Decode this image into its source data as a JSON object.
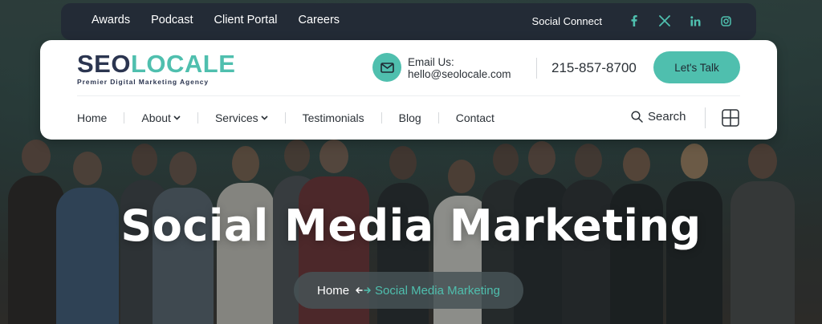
{
  "topbar": {
    "links": [
      "Awards",
      "Podcast",
      "Client Portal",
      "Careers"
    ],
    "social_label": "Social Connect",
    "social_icons": [
      "facebook-icon",
      "x-icon",
      "linkedin-icon",
      "instagram-icon"
    ]
  },
  "header": {
    "logo": {
      "seo": "SEO",
      "locale": "LOCALE",
      "tagline": "Premier Digital Marketing Agency"
    },
    "email_label": "Email Us:",
    "email": "hello@seolocale.com",
    "phone": "215-857-8700",
    "cta": "Let's Talk"
  },
  "nav": {
    "items": [
      "Home",
      "About",
      "Services",
      "Testimonials",
      "Blog",
      "Contact"
    ],
    "search_label": "Search"
  },
  "hero": {
    "title": "Social Media Marketing",
    "breadcrumb": {
      "home": "Home",
      "current": "Social Media Marketing"
    }
  },
  "colors": {
    "accent": "#4fbfae",
    "navy": "#2b3550",
    "topbar": "#232b36"
  }
}
